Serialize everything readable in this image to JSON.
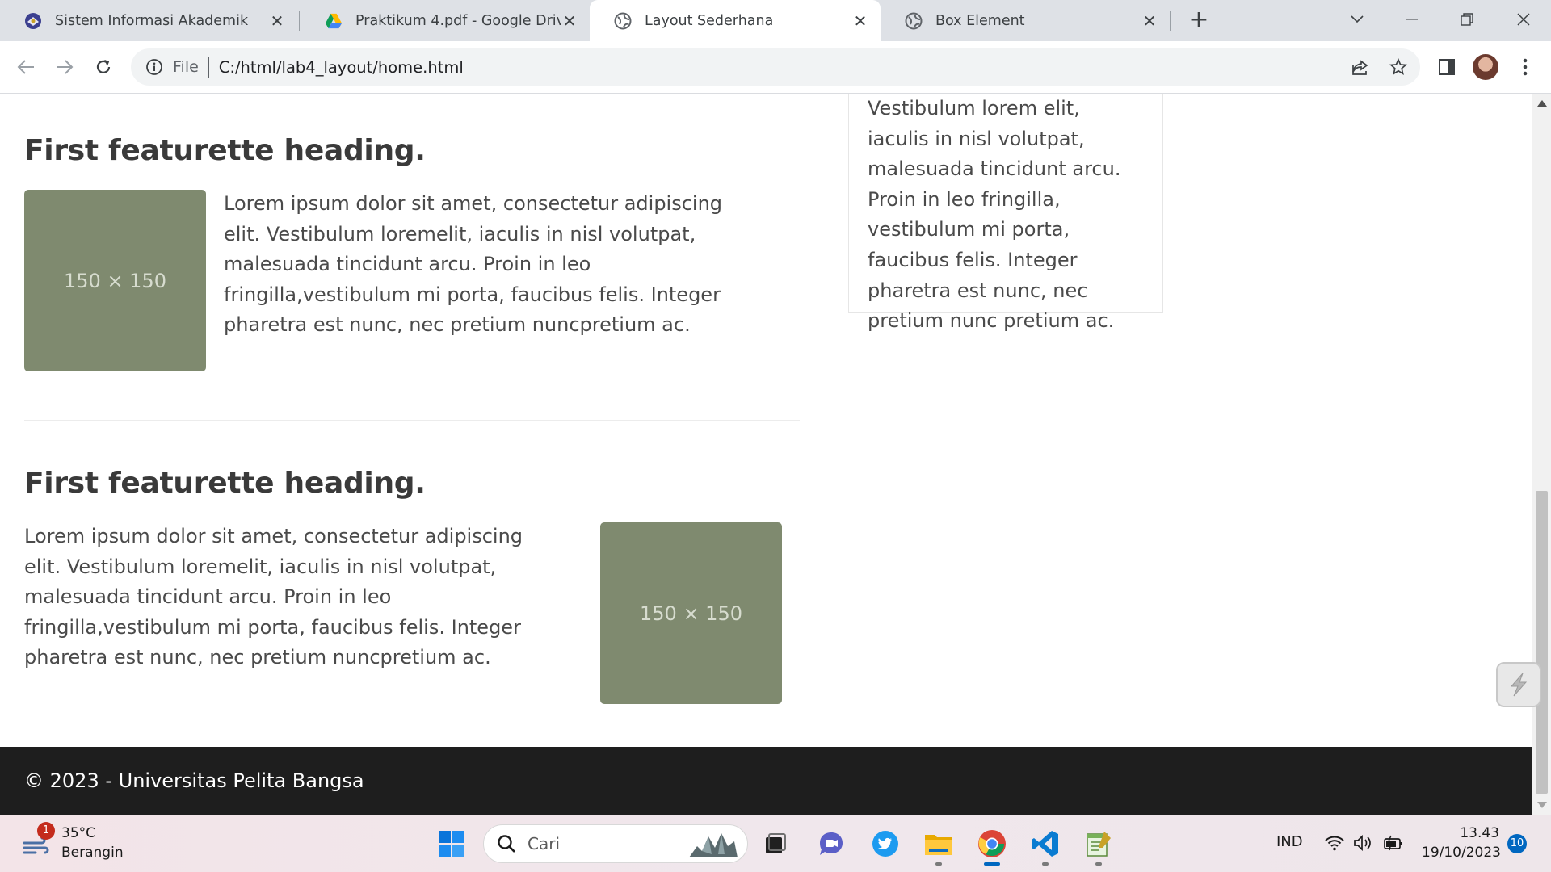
{
  "browser": {
    "tabs": [
      {
        "title": "Sistem Informasi Akademik",
        "icon": "academic-globe-icon"
      },
      {
        "title": "Praktikum 4.pdf - Google Drive",
        "icon": "google-drive-icon"
      },
      {
        "title": "Layout Sederhana",
        "icon": "globe-icon",
        "active": true
      },
      {
        "title": "Box Element",
        "icon": "globe-icon"
      }
    ],
    "address": {
      "scheme": "File",
      "url": "C:/html/lab4_layout/home.html"
    }
  },
  "page": {
    "sidebox_text": "Vestibulum lorem elit, iaculis in nisl volutpat, malesuada tincidunt arcu. Proin in leo fringilla, vestibulum mi porta, faucibus felis. Integer pharetra est nunc, nec pretium nunc pretium ac.",
    "featurettes": [
      {
        "heading": "First featurette heading.",
        "image_label": "150 × 150",
        "text": "Lorem ipsum dolor sit amet, consectetur adipiscing elit. Vestibulum loremelit, iaculis in nisl volutpat, malesuada tincidunt arcu. Proin in leo fringilla,vestibulum mi porta, faucibus felis. Integer pharetra est nunc, nec pretium nuncpretium ac."
      },
      {
        "heading": "First featurette heading.",
        "image_label": "150 × 150",
        "text": "Lorem ipsum dolor sit amet, consectetur adipiscing elit. Vestibulum loremelit, iaculis in nisl volutpat, malesuada tincidunt arcu. Proin in leo fringilla,vestibulum mi porta, faucibus felis. Integer pharetra est nunc, nec pretium nuncpretium ac."
      }
    ],
    "footer": "© 2023 - Universitas Pelita Bangsa"
  },
  "taskbar": {
    "weather": {
      "temp": "35°C",
      "condition": "Berangin",
      "alerts": "1"
    },
    "search_placeholder": "Cari",
    "apps": [
      "windows-start-icon",
      "task-view-icon",
      "teams-chat-icon",
      "twitter-icon",
      "file-explorer-icon",
      "chrome-icon",
      "vscode-icon",
      "notepad-icon"
    ],
    "language": "IND",
    "time": "13.43",
    "date": "19/10/2023",
    "notifications": "10"
  },
  "colors": {
    "placeholder_bg": "#7f8a6f",
    "footer_bg": "#1e1e1e",
    "accent": "#0067c0"
  }
}
